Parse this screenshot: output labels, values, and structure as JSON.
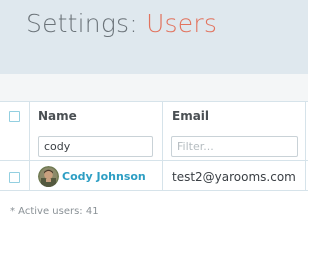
{
  "header": {
    "title_prefix": "Settings:",
    "title_section": "Users"
  },
  "table": {
    "columns": {
      "name": "Name",
      "email": "Email"
    },
    "filters": {
      "name_value": "cody",
      "name_placeholder": "",
      "email_value": "",
      "email_placeholder": "Filter..."
    },
    "rows": [
      {
        "name": "Cody Johnson",
        "email": "test2@yarooms.com",
        "avatar_icon": "user-avatar-photo"
      }
    ]
  },
  "footer": {
    "active_users": "* Active users: 41"
  },
  "colors": {
    "accent": "#e2735e",
    "link": "#2d9ec3",
    "header_bg": "#dfe8ee"
  }
}
